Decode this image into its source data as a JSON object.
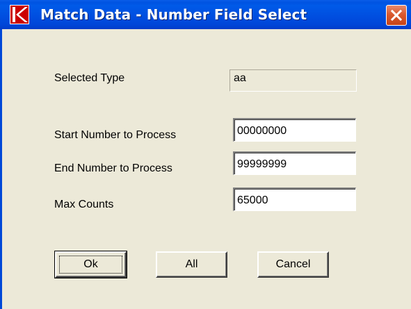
{
  "window": {
    "title": "Match Data - Number Field Select"
  },
  "form": {
    "selected_type_label": "Selected Type",
    "selected_type_value": "aa",
    "start_label": "Start Number to Process",
    "start_value": "00000000",
    "end_label": "End Number to Process",
    "end_value": "99999999",
    "max_label": "Max Counts",
    "max_value": "65000"
  },
  "buttons": {
    "ok": "Ok",
    "all": "All",
    "cancel": "Cancel"
  },
  "colors": {
    "titlebar": "#0053e1",
    "close_button": "#d9592f",
    "dialog_face": "#ece9d8"
  }
}
